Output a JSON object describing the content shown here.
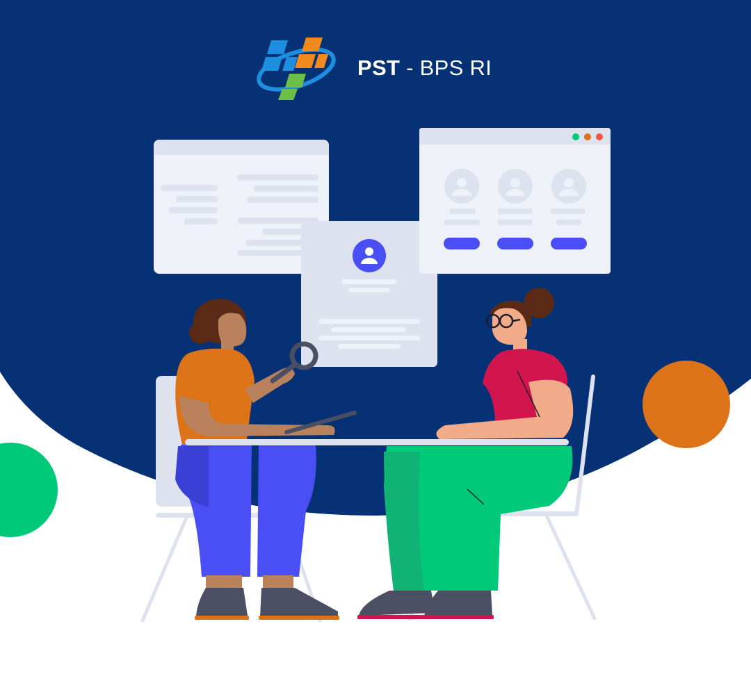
{
  "brand": {
    "name_bold": "PST",
    "name_rest": "- BPS RI"
  },
  "colors": {
    "navy": "#063175",
    "panel": "#EEF1F8",
    "panel_header": "#DEE2EF",
    "accent_blue": "#4A4EF5",
    "orange": "#DD7318",
    "green": "#00CA7A",
    "magenta": "#D3154F",
    "skin_dark": "#B9825C",
    "skin_light": "#F2AB88",
    "hair": "#5A2A17"
  },
  "illustration": {
    "profile_cards": 3,
    "window_dots": [
      "green-dot",
      "orange-dot",
      "red-dot"
    ]
  }
}
